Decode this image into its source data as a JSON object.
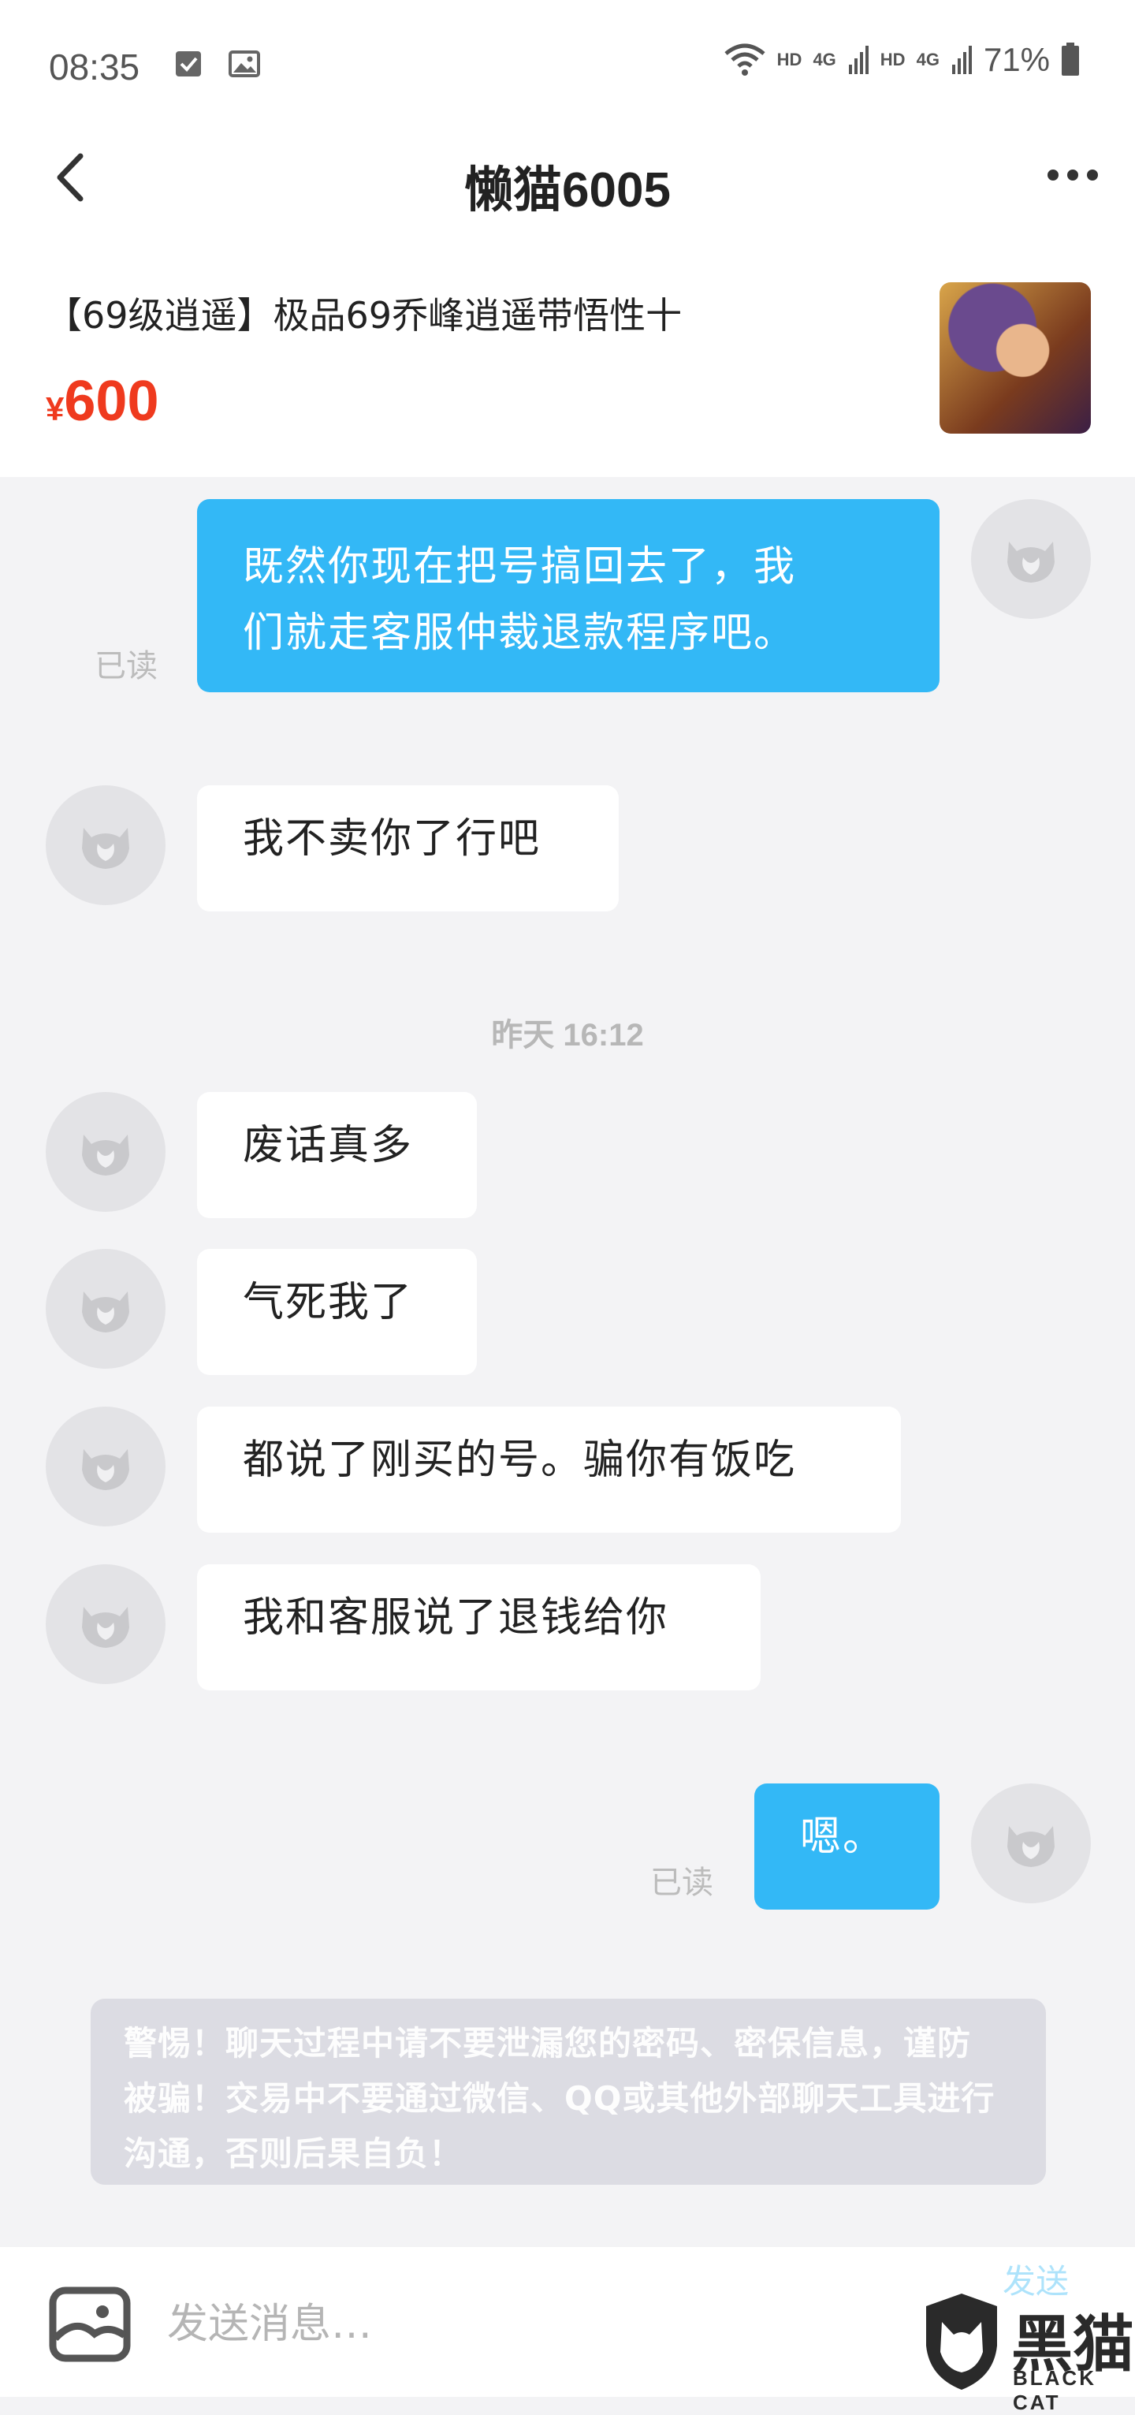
{
  "status_bar": {
    "time": "08:35",
    "left_icons": [
      "check-square-icon",
      "image-icon"
    ],
    "right_icons": [
      "wifi-icon",
      "signal-icon",
      "signal-icon",
      "battery-icon"
    ],
    "hd1": "HD",
    "net1": "4G",
    "hd2": "HD",
    "net2": "4G",
    "battery": "71%"
  },
  "header": {
    "title": "懒猫6005"
  },
  "product": {
    "title": "【69级逍遥】极品69乔峰逍遥带悟性十",
    "currency": "¥",
    "price": "600"
  },
  "messages": [
    {
      "side": "out",
      "text_line1": "既然你现在把号搞回去了，我",
      "text_line2": "们就走客服仲裁退款程序吧。",
      "read": "已读"
    },
    {
      "side": "in",
      "text": "我不卖你了行吧"
    },
    {
      "divider": "昨天 16:12"
    },
    {
      "side": "in",
      "text": "废话真多"
    },
    {
      "side": "in",
      "text": "气死我了"
    },
    {
      "side": "in",
      "text": "都说了刚买的号。骗你有饭吃"
    },
    {
      "side": "in",
      "text": "我和客服说了退钱给你"
    },
    {
      "side": "out",
      "text": "嗯。",
      "read": "已读"
    }
  ],
  "warning": {
    "line1": "警惕！聊天过程中请不要泄漏您的密码、密保信息，谨防",
    "line2": "被骗！交易中不要通过微信、QQ或其他外部聊天工具进行",
    "line3": "沟通，否则后果自负！"
  },
  "input": {
    "placeholder": "发送消息…",
    "send_label": "发送"
  },
  "watermark": {
    "text": "黑猫",
    "sub": "BLACK CAT"
  },
  "colors": {
    "accent": "#33b8f6",
    "price": "#ef3a1e",
    "background": "#f3f3f5",
    "warning_bg": "#dcdce3"
  }
}
